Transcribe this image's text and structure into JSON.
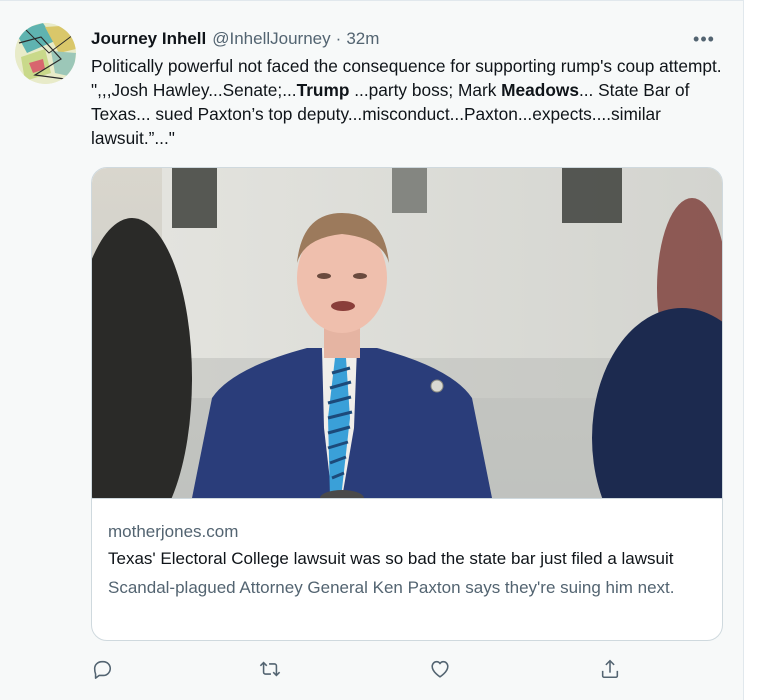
{
  "tweet": {
    "author_name": "Journey Inhell",
    "handle": "@InhellJourney",
    "separator": "·",
    "time": "32m",
    "more_label": "•••",
    "text": {
      "seg1": "Politically powerful not faced the consequence for supporting rump's coup attempt. \",,,Josh Hawley...Senate;...",
      "bold1": "Trump",
      "seg2": " ...party boss; Mark ",
      "bold2": "Meadows",
      "seg3": "... State Bar of Texas... sued Paxton’s top deputy...misconduct...Paxton...expects....similar lawsuit.”...\""
    }
  },
  "card": {
    "domain": "motherjones.com",
    "title": "Texas' Electoral College lawsuit was so bad the state bar just filed a lawsuit",
    "description": "Scandal-plagued Attorney General Ken Paxton says they're suing him next."
  },
  "actions": {
    "reply_icon": "reply-icon",
    "retweet_icon": "retweet-icon",
    "like_icon": "heart-icon",
    "share_icon": "share-icon"
  },
  "colors": {
    "background": "#f7f9f9",
    "text": "#0f1419",
    "secondary": "#536471",
    "border": "#cfd9de"
  }
}
